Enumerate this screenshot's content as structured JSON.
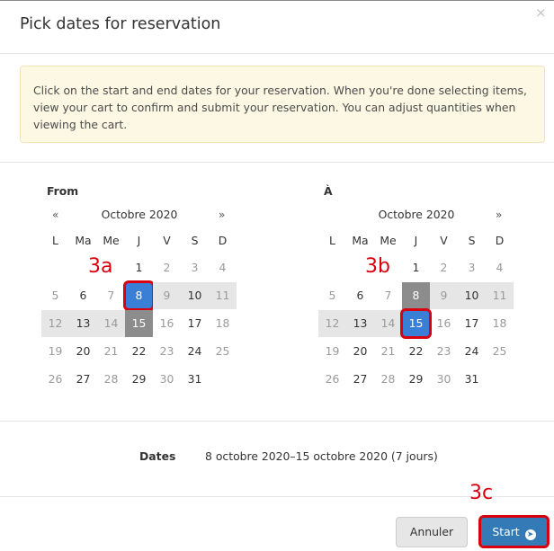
{
  "modal": {
    "title": "Pick dates for reservation",
    "close_label": "×"
  },
  "info": {
    "text": "Click on the start and end dates for your reservation. When you're done selecting items, view your cart to confirm and submit your reservation. You can adjust quantities when viewing the cart."
  },
  "calendars": [
    {
      "heading": "From",
      "month": "Octobre 2020",
      "prev": "«",
      "next": "»",
      "weekdays": [
        "L",
        "Ma",
        "Me",
        "J",
        "V",
        "S",
        "D"
      ],
      "step": "3a",
      "weeks": [
        [
          "",
          "",
          "",
          "1",
          "2",
          "3",
          "4"
        ],
        [
          "5",
          "6",
          "7",
          "8",
          "9",
          "10",
          "11"
        ],
        [
          "12",
          "13",
          "14",
          "15",
          "16",
          "17",
          "18"
        ],
        [
          "19",
          "20",
          "21",
          "22",
          "23",
          "24",
          "25"
        ],
        [
          "26",
          "27",
          "28",
          "29",
          "30",
          "31",
          ""
        ]
      ],
      "selected_day": "8",
      "highlight_day": "15",
      "range": [
        "8",
        "15"
      ]
    },
    {
      "heading": "À",
      "month": "Octobre 2020",
      "prev": "",
      "next": "»",
      "weekdays": [
        "L",
        "Ma",
        "Me",
        "J",
        "V",
        "S",
        "D"
      ],
      "step": "3b",
      "weeks": [
        [
          "",
          "",
          "",
          "1",
          "2",
          "3",
          "4"
        ],
        [
          "5",
          "6",
          "7",
          "8",
          "9",
          "10",
          "11"
        ],
        [
          "12",
          "13",
          "14",
          "15",
          "16",
          "17",
          "18"
        ],
        [
          "19",
          "20",
          "21",
          "22",
          "23",
          "24",
          "25"
        ],
        [
          "26",
          "27",
          "28",
          "29",
          "30",
          "31",
          ""
        ]
      ],
      "selected_day": "15",
      "highlight_day": "8",
      "range": [
        "8",
        "15"
      ]
    }
  ],
  "summary": {
    "label": "Dates",
    "value": "8 octobre 2020–15 octobre 2020 (7 jours)"
  },
  "footer": {
    "step": "3c",
    "cancel_label": "Annuler",
    "start_label": "Start"
  },
  "colors": {
    "accent": "#337ab7",
    "selected_day": "#3a7fd6",
    "annotation": "#d8000f",
    "info_bg": "#fcf8e3"
  }
}
